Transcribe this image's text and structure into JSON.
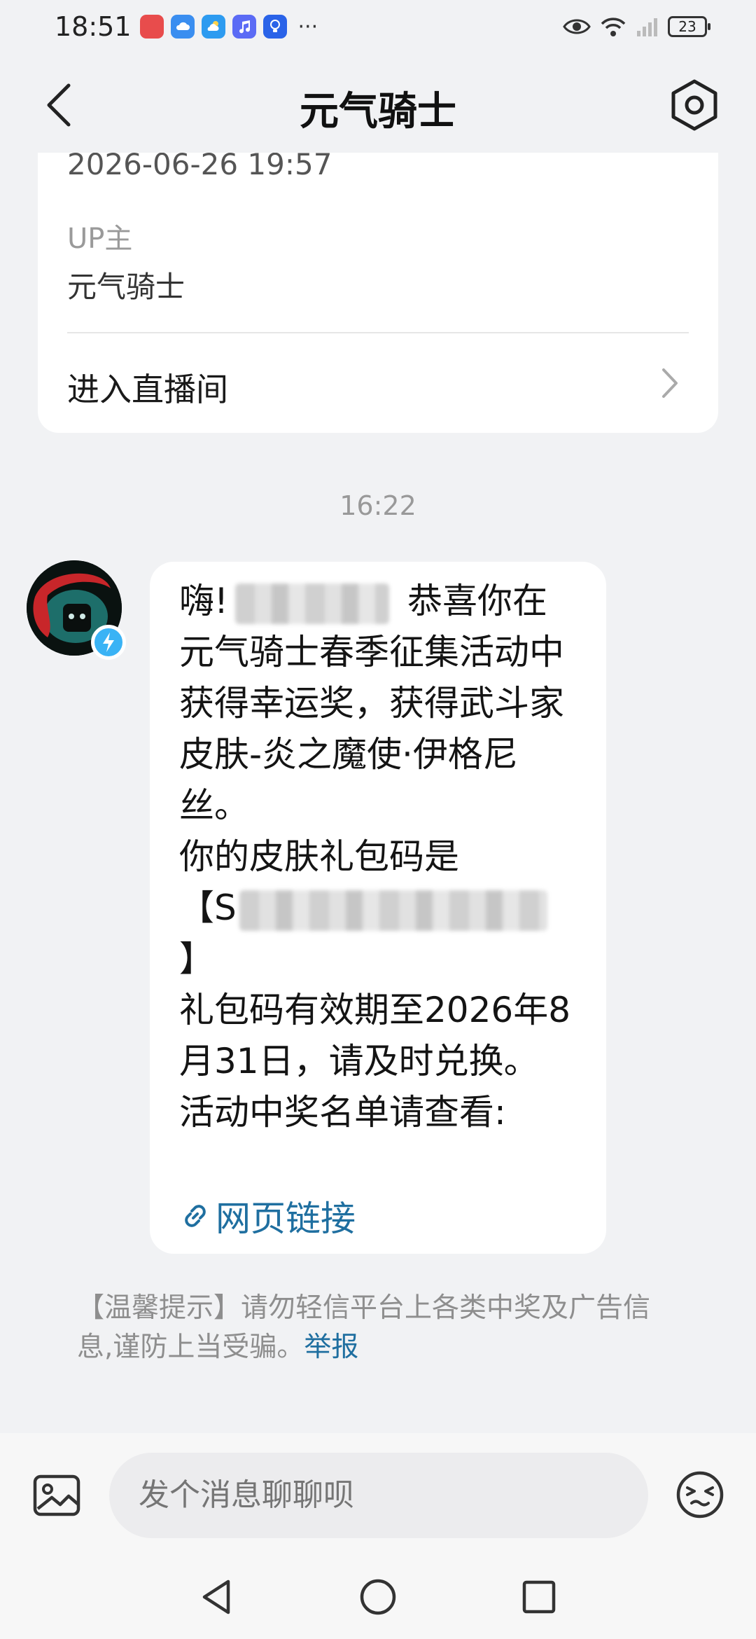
{
  "status_bar": {
    "time": "18:51",
    "app_icons": [
      "huawei-store-icon",
      "cloud-icon",
      "weather-icon",
      "music-icon",
      "tips-icon"
    ],
    "more": "···",
    "battery": "23"
  },
  "header": {
    "title": "元气骑士"
  },
  "live_card": {
    "date": "2026-06-26 19:57",
    "up_label": "UP主",
    "up_name": "元气骑士",
    "enter_label": "进入直播间"
  },
  "chat": {
    "timestamp": "16:22",
    "message": {
      "line_greeting_start": "嗨!",
      "line_greeting_end": "恭喜你",
      "body": "在元气骑士春季征集活动中获得幸运奖，获得武斗家皮肤-炎之魔使·伊格尼丝。\n你的皮肤礼包码是\n【S",
      "code_close": "\n】\n礼包码有效期至2026年8月31日，请及时兑换。\n活动中奖名单请查看:",
      "link_text": "网页链接"
    }
  },
  "tip": {
    "text": "【温馨提示】请勿轻信平台上各类中奖及广告信息,谨防上当受骗。",
    "report": "举报"
  },
  "input": {
    "placeholder": "发个消息聊聊呗"
  },
  "colors": {
    "background": "#f1f2f4",
    "link": "#1f6fa0",
    "badge": "#3ab3f5"
  }
}
